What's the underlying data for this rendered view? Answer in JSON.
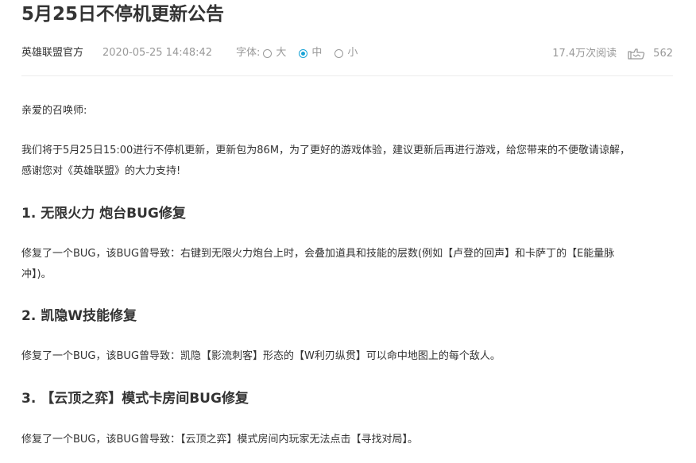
{
  "article": {
    "title": "5月25日不停机更新公告",
    "author": "英雄联盟官方",
    "date": "2020-05-25 14:48:42",
    "font_label": "字体:",
    "font_options": [
      {
        "label": "大",
        "selected": false
      },
      {
        "label": "中",
        "selected": true
      },
      {
        "label": "小",
        "selected": false
      }
    ],
    "views": "17.4万次阅读",
    "likes": "562",
    "greeting": "亲爱的召唤师:",
    "intro_line1": "我们将于5月25日15:00进行不停机更新，更新包为86M，为了更好的游戏体验，建议更新后再进行游戏，给您带来的不便敬请谅解，",
    "intro_line2": "感谢您对《英雄联盟》的大力支持!",
    "sections": [
      {
        "heading": "1. 无限火力 炮台BUG修复",
        "line1": "修复了一个BUG，该BUG曾导致：右键到无限火力炮台上时，会叠加道具和技能的层数(例如【卢登的回声】和卡萨丁的【E能量脉",
        "line2": "冲】)。"
      },
      {
        "heading": "2. 凯隐W技能修复",
        "line1": "修复了一个BUG，该BUG曾导致：凯隐【影流刺客】形态的【W利刃纵贯】可以命中地图上的每个敌人。"
      },
      {
        "heading": "3. 【云顶之弈】模式卡房间BUG修复",
        "line1": "修复了一个BUG，该BUG曾导致：【云顶之弈】模式房间内玩家无法点击【寻找对局】。"
      }
    ]
  },
  "colors": {
    "accent": "#19a3d6",
    "text": "#333333",
    "muted": "#999999"
  },
  "icons": {
    "likes": "thumbs-up-icon"
  }
}
